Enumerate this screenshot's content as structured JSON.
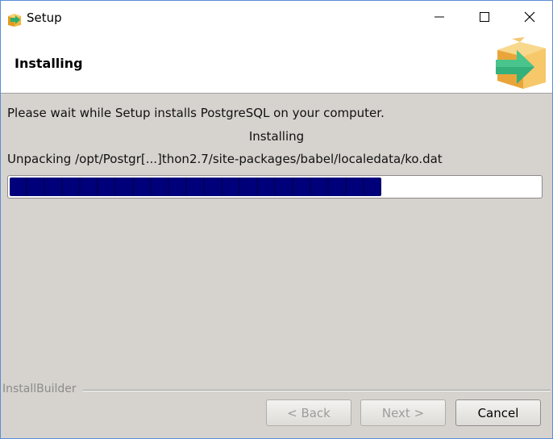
{
  "window": {
    "title": "Setup",
    "controls": {
      "minimize": "minimize-icon",
      "maximize": "maximize-icon",
      "close": "close-icon"
    }
  },
  "header": {
    "title": "Installing",
    "logo_icon": "box-arrow-icon"
  },
  "body": {
    "message": "Please wait while Setup installs PostgreSQL on your computer.",
    "status": "Installing",
    "detail": "Unpacking /opt/Postgr[...]thon2.7/site-packages/babel/localedata/ko.dat",
    "progress_percent": 70
  },
  "footer": {
    "builder_label": "InstallBuilder",
    "back_label": "< Back",
    "next_label": "Next >",
    "cancel_label": "Cancel"
  },
  "colors": {
    "progress_fill": "#00007a",
    "window_bg": "#d6d3ce",
    "accent_border": "#5a8dd6"
  }
}
